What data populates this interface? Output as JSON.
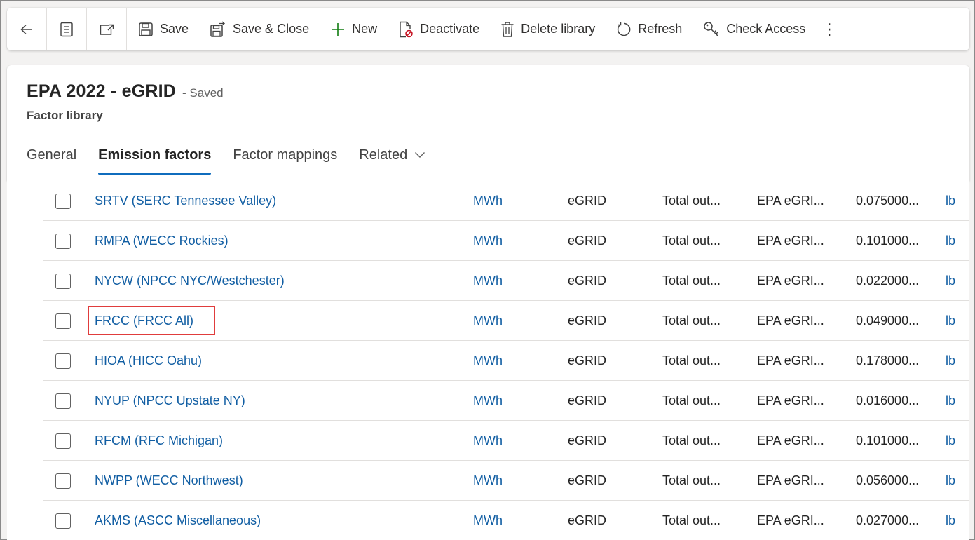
{
  "toolbar": {
    "save_label": "Save",
    "save_close_label": "Save & Close",
    "new_label": "New",
    "deactivate_label": "Deactivate",
    "delete_label": "Delete library",
    "refresh_label": "Refresh",
    "check_access_label": "Check Access",
    "more_label": "⋮"
  },
  "header": {
    "title": "EPA 2022 - eGRID",
    "status": "- Saved",
    "entity": "Factor library"
  },
  "tabs": [
    {
      "label": "General"
    },
    {
      "label": "Emission factors"
    },
    {
      "label": "Factor mappings"
    },
    {
      "label": "Related"
    }
  ],
  "rows": [
    {
      "name": "SRTV (SERC Tennessee Valley)",
      "unit": "MWh",
      "source": "eGRID",
      "total": "Total out...",
      "library": "EPA eGRI...",
      "value": "0.075000...",
      "lb": "lb"
    },
    {
      "name": "RMPA (WECC Rockies)",
      "unit": "MWh",
      "source": "eGRID",
      "total": "Total out...",
      "library": "EPA eGRI...",
      "value": "0.101000...",
      "lb": "lb"
    },
    {
      "name": "NYCW (NPCC NYC/Westchester)",
      "unit": "MWh",
      "source": "eGRID",
      "total": "Total out...",
      "library": "EPA eGRI...",
      "value": "0.022000...",
      "lb": "lb"
    },
    {
      "name": "FRCC (FRCC All)",
      "unit": "MWh",
      "source": "eGRID",
      "total": "Total out...",
      "library": "EPA eGRI...",
      "value": "0.049000...",
      "lb": "lb"
    },
    {
      "name": "HIOA (HICC Oahu)",
      "unit": "MWh",
      "source": "eGRID",
      "total": "Total out...",
      "library": "EPA eGRI...",
      "value": "0.178000...",
      "lb": "lb"
    },
    {
      "name": "NYUP (NPCC Upstate NY)",
      "unit": "MWh",
      "source": "eGRID",
      "total": "Total out...",
      "library": "EPA eGRI...",
      "value": "0.016000...",
      "lb": "lb"
    },
    {
      "name": "RFCM (RFC Michigan)",
      "unit": "MWh",
      "source": "eGRID",
      "total": "Total out...",
      "library": "EPA eGRI...",
      "value": "0.101000...",
      "lb": "lb"
    },
    {
      "name": "NWPP (WECC Northwest)",
      "unit": "MWh",
      "source": "eGRID",
      "total": "Total out...",
      "library": "EPA eGRI...",
      "value": "0.056000...",
      "lb": "lb"
    },
    {
      "name": "AKMS (ASCC Miscellaneous)",
      "unit": "MWh",
      "source": "eGRID",
      "total": "Total out...",
      "library": "EPA eGRI...",
      "value": "0.027000...",
      "lb": "lb"
    }
  ],
  "highlight_color": "#e03c3c",
  "accent_color": "#0f6cbd"
}
